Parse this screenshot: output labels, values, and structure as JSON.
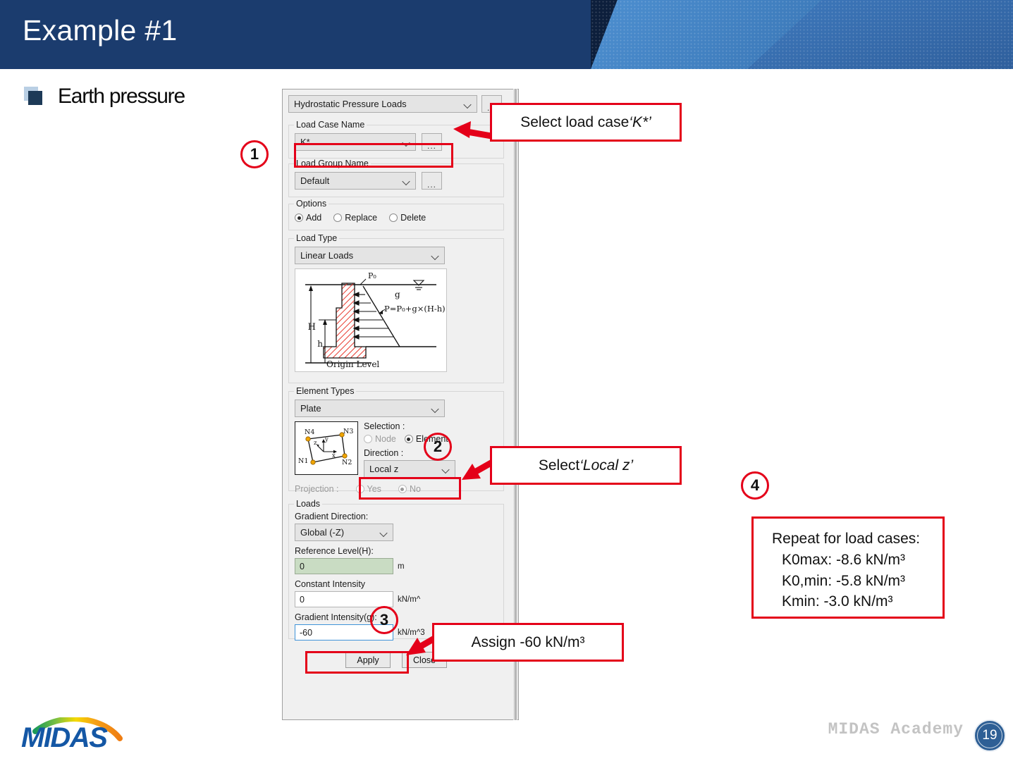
{
  "slide": {
    "title": "Example #1",
    "bullet": "Earth pressure",
    "page_number": "19",
    "footer_brand": "MIDAS Academy",
    "logo_text": "MIDAS"
  },
  "dialog": {
    "load_type_selector": "Hydrostatic Pressure Loads",
    "ellipsis_label": "...",
    "load_case": {
      "legend": "Load Case Name",
      "value": "K*",
      "button": "..."
    },
    "load_group": {
      "legend": "Load Group Name",
      "value": "Default",
      "button": "..."
    },
    "options": {
      "legend": "Options",
      "items": [
        {
          "label": "Add",
          "selected": true
        },
        {
          "label": "Replace",
          "selected": false
        },
        {
          "label": "Delete",
          "selected": false
        }
      ]
    },
    "load_type": {
      "legend": "Load Type",
      "value": "Linear Loads",
      "figure": {
        "p0": "P₀",
        "g": "g",
        "formula": "P=P₀+g×(H-h)",
        "H": "H",
        "h": "h",
        "origin": "Origin Level"
      }
    },
    "element_types": {
      "legend": "Element Types",
      "value": "Plate",
      "nodes": [
        "N1",
        "N2",
        "N3",
        "N4"
      ],
      "axes": [
        "x",
        "y",
        "z"
      ],
      "selection_label": "Selection :",
      "selection_options": [
        {
          "label": "Node",
          "selected": false
        },
        {
          "label": "Element",
          "selected": true
        }
      ],
      "direction_label": "Direction :",
      "direction_value": "Local z",
      "projection_label": "Projection :",
      "projection_options": [
        {
          "label": "Yes",
          "selected": false
        },
        {
          "label": "No",
          "selected": true
        }
      ]
    },
    "loads": {
      "legend": "Loads",
      "gradient_direction_label": "Gradient Direction:",
      "gradient_direction_value": "Global (-Z)",
      "reference_level_label": "Reference Level(H):",
      "reference_level_value": "0",
      "reference_level_unit": "m",
      "constant_intensity_label": "Constant Intensity",
      "constant_intensity_value": "0",
      "constant_intensity_unit": "kN/m^",
      "gradient_intensity_label": "Gradient Intensity(g):",
      "gradient_intensity_value": "-60",
      "gradient_intensity_unit": "kN/m^3"
    },
    "buttons": {
      "apply": "Apply",
      "close": "Close"
    }
  },
  "annotations": {
    "step1": "1",
    "step2": "2",
    "step3": "3",
    "step4": "4",
    "callout1_prefix": "Select load case ",
    "callout1_em": "‘K*’",
    "callout2_prefix": "Select ",
    "callout2_em": "‘Local z’",
    "callout3": "Assign -60 kN/m³",
    "callout4": {
      "line1": "Repeat for load cases:",
      "line2": "K0max: -8.6 kN/m³",
      "line3": "K0,min: -5.8 kN/m³",
      "line4": "Kmin: -3.0 kN/m³"
    }
  },
  "colors": {
    "header_blue": "#1b3c6e",
    "accent_red": "#e40019",
    "green_field": "#c9dcc3",
    "logo_blue": "#1457a5"
  }
}
